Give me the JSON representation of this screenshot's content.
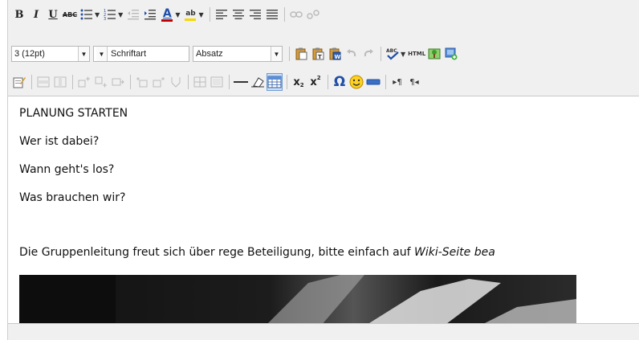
{
  "toolbar": {
    "row1": {
      "bold": "B",
      "italic": "I",
      "underline": "U",
      "strike": "ABC",
      "bullet_list_icon": "bulleted-list-icon",
      "numbered_list_icon": "numbered-list-icon",
      "outdent_icon": "outdent-icon",
      "indent_icon": "indent-icon",
      "font_color": "A",
      "highlight": "ab"
    },
    "row2": {
      "font_size": "3 (12pt)",
      "font_family": "Schriftart",
      "paragraph": "Absatz",
      "html_label": "HTML"
    },
    "row3": {
      "subscript": "x",
      "superscript": "x",
      "omega": "Ω",
      "ltr_label": "▸¶",
      "rtl_label": "¶◂"
    }
  },
  "content": {
    "line1": "PLANUNG STARTEN",
    "line2": "Wer ist dabei?",
    "line3": "Wann geht's los?",
    "line4": "Was brauchen wir?",
    "line5_plain": "Die Gruppenleitung freut sich über rege Beteiligung, bitte einfach auf ",
    "line5_italic": "Wiki-Seite bea"
  },
  "colors": {
    "toolbar_bg": "#f0f0f0",
    "accent_blue": "#1f4fa8",
    "font_red": "#c00000",
    "highlight_yellow": "#f6d700"
  }
}
